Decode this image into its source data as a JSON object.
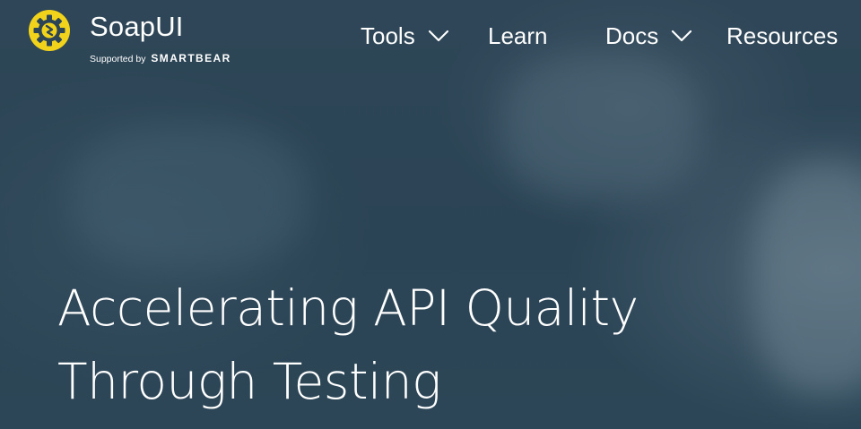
{
  "brand": {
    "name": "SoapUI",
    "supported_by": "Supported by",
    "company": "SMARTBEAR",
    "accent_color": "#f2d31b"
  },
  "nav": {
    "items": [
      {
        "label": "Tools",
        "has_dropdown": true
      },
      {
        "label": "Learn",
        "has_dropdown": false
      },
      {
        "label": "Docs",
        "has_dropdown": true
      },
      {
        "label": "Resources",
        "has_dropdown": false
      }
    ]
  },
  "hero": {
    "headline_line1": "Accelerating API Quality",
    "headline_line2": "Through Testing"
  },
  "colors": {
    "background": "#2c4556",
    "text": "#ffffff"
  }
}
